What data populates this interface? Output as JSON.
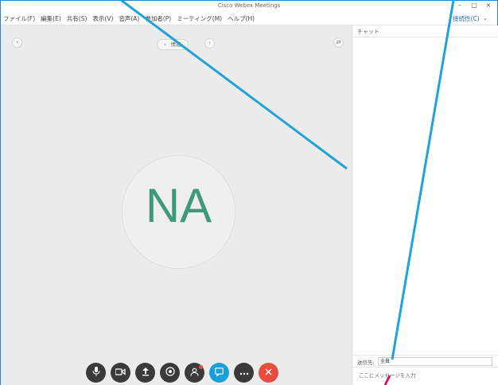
{
  "window": {
    "title": "Cisco Webex Meetings",
    "controls": [
      "–",
      "□",
      "×"
    ]
  },
  "menubar": {
    "items": [
      "ファイル(F)",
      "編集(E)",
      "共有(S)",
      "表示(V)",
      "音声(A)",
      "参加者(P)",
      "ミーティング(M)",
      "ヘルプ(H)"
    ],
    "right_label": "接続性(C)",
    "right_chevron": "⌄"
  },
  "stage": {
    "collapse_left_label": "‹",
    "share_pill_text": "情報",
    "share_prev": "‹",
    "share_next": "›",
    "right_circle_label": "⇄",
    "avatar_initials": "NA",
    "controls": [
      {
        "icon": "microphone-icon",
        "glyph": "🎙"
      },
      {
        "icon": "video-icon",
        "glyph": "▶"
      },
      {
        "icon": "share-icon",
        "glyph": "⇧"
      },
      {
        "icon": "record-icon",
        "glyph": "◎"
      },
      {
        "icon": "participants-icon",
        "glyph": "☺"
      },
      {
        "icon": "chat-icon",
        "glyph": "▢"
      },
      {
        "icon": "more-icon",
        "glyph": "•••"
      },
      {
        "icon": "end-call-icon",
        "glyph": "✕"
      }
    ]
  },
  "panel": {
    "header_label": "チャット",
    "recipient_label": "送信先:",
    "recipient_value": "全員",
    "input_placeholder": "ここにメッセージを入力"
  },
  "colors": {
    "window_border": "#1f86c9",
    "avatar_text": "#3f9a7c",
    "annotation_blue": "#1fa3d9",
    "annotation_magenta": "#d4166b",
    "end_call": "#e84c3f",
    "active_control": "#1c9fd8"
  }
}
